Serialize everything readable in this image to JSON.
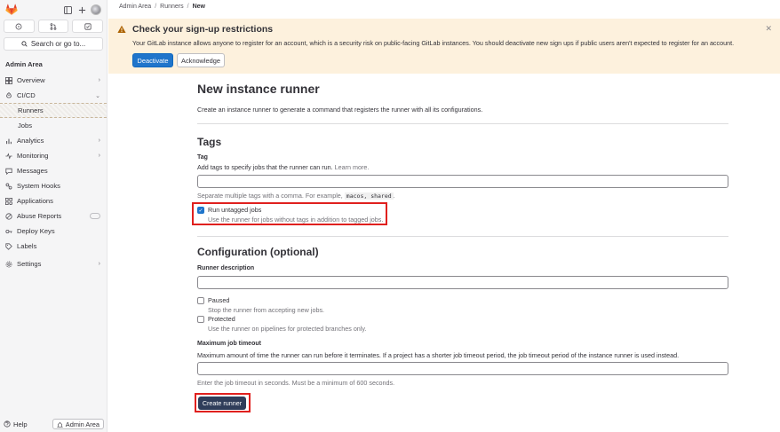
{
  "sidebar": {
    "title": "Admin Area",
    "search_label": "Search or go to...",
    "items": [
      {
        "label": "Overview",
        "icon": "overview-icon",
        "chevron": "›"
      },
      {
        "label": "CI/CD",
        "icon": "rocket-icon",
        "chevron": "⌄"
      },
      {
        "label": "Runners",
        "icon": "",
        "active": true
      },
      {
        "label": "Jobs",
        "icon": ""
      },
      {
        "label": "Analytics",
        "icon": "chart-icon",
        "chevron": "›"
      },
      {
        "label": "Monitoring",
        "icon": "monitor-icon",
        "chevron": "›"
      },
      {
        "label": "Messages",
        "icon": "message-icon"
      },
      {
        "label": "System Hooks",
        "icon": "hook-icon"
      },
      {
        "label": "Applications",
        "icon": "apps-icon"
      },
      {
        "label": "Abuse Reports",
        "icon": "abuse-icon"
      },
      {
        "label": "Deploy Keys",
        "icon": "key-icon"
      },
      {
        "label": "Labels",
        "icon": "label-icon"
      },
      {
        "label": "Settings",
        "icon": "settings-icon",
        "chevron": "›"
      }
    ],
    "help_label": "Help",
    "admin_button_label": "Admin Area"
  },
  "breadcrumb": {
    "items": [
      "Admin Area",
      "Runners",
      "New"
    ]
  },
  "alert": {
    "title": "Check your sign-up restrictions",
    "body": "Your GitLab instance allows anyone to register for an account, which is a security risk on public-facing GitLab instances. You should deactivate new sign ups if public users aren't expected to register for an account.",
    "primary_label": "Deactivate",
    "secondary_label": "Acknowledge",
    "accent_color": "#fdf1dd"
  },
  "form": {
    "title": "New instance runner",
    "description": "Create an instance runner to generate a command that registers the runner with all its configurations.",
    "tags_heading": "Tags",
    "tag_label": "Tag",
    "tag_help_text": "Add tags to specify jobs that the runner can run.",
    "tag_help_link": "Learn more.",
    "tag_hint_prefix": "Separate multiple tags with a comma. For example,",
    "tag_hint_example": "macos, shared",
    "tag_hint_suffix": ".",
    "tag_value": "",
    "run_untagged_label": "Run untagged jobs",
    "run_untagged_help": "Use the runner for jobs without tags in addition to tagged jobs.",
    "run_untagged_checked": true,
    "config_heading": "Configuration (optional)",
    "description_label": "Runner description",
    "description_value": "",
    "paused_label": "Paused",
    "paused_help": "Stop the runner from accepting new jobs.",
    "protected_label": "Protected",
    "protected_help": "Use the runner on pipelines for protected branches only.",
    "timeout_label": "Maximum job timeout",
    "timeout_help": "Maximum amount of time the runner can run before it terminates. If a project has a shorter job timeout period, the job timeout period of the instance runner is used instead.",
    "timeout_value": "",
    "timeout_hint": "Enter the job timeout in seconds. Must be a minimum of 600 seconds.",
    "submit_label": "Create runner"
  },
  "colors": {
    "primary": "#1f75cb",
    "submit": "#2f3d5a",
    "highlight": "#e0201e"
  }
}
